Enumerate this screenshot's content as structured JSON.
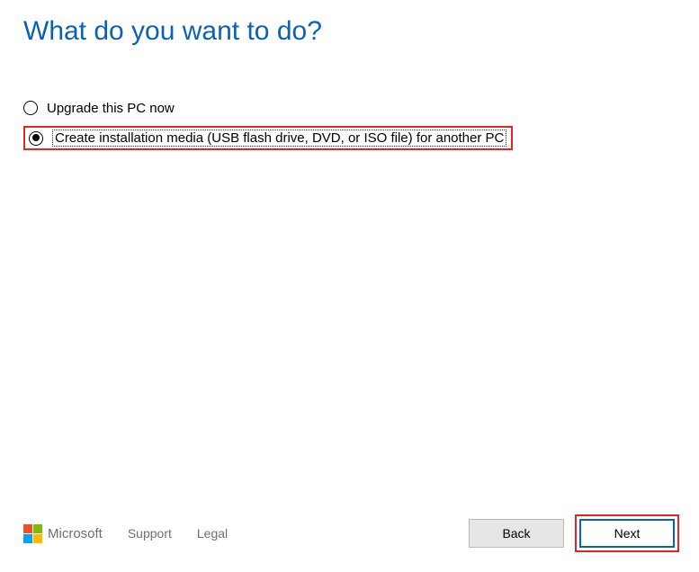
{
  "heading": "What do you want to do?",
  "options": {
    "upgrade": {
      "label": "Upgrade this PC now",
      "selected": false
    },
    "create_media": {
      "label": "Create installation media (USB flash drive, DVD, or ISO file) for another PC",
      "selected": true
    }
  },
  "footer": {
    "brand": "Microsoft",
    "support": "Support",
    "legal": "Legal"
  },
  "buttons": {
    "back": "Back",
    "next": "Next"
  }
}
